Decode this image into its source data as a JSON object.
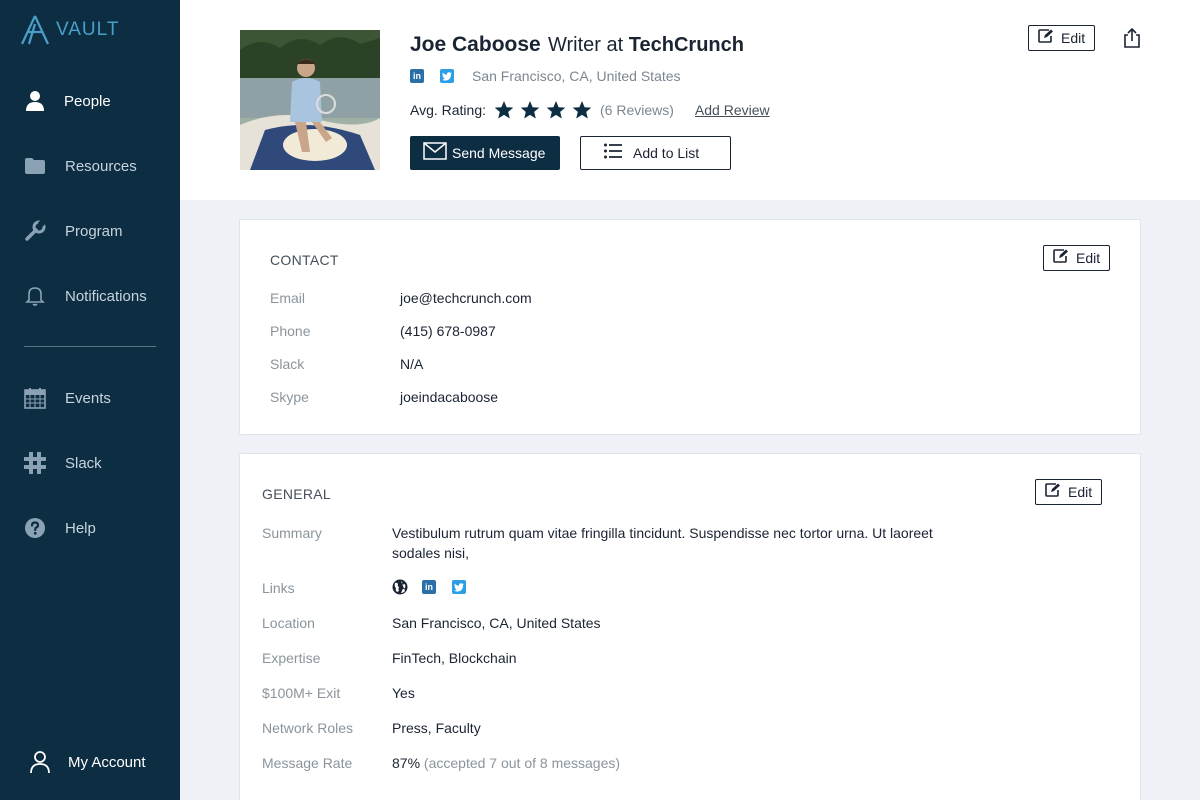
{
  "brand": {
    "name": "VAULT"
  },
  "sidebar": {
    "items": [
      {
        "label": "People",
        "icon": "person-icon"
      },
      {
        "label": "Resources",
        "icon": "folder-icon"
      },
      {
        "label": "Program",
        "icon": "wrench-icon"
      },
      {
        "label": "Notifications",
        "icon": "bell-icon"
      },
      {
        "label": "Events",
        "icon": "calendar-icon"
      },
      {
        "label": "Slack",
        "icon": "slack-icon"
      },
      {
        "label": "Help",
        "icon": "help-icon"
      }
    ],
    "account_label": "My Account"
  },
  "profile": {
    "name": "Joe Caboose",
    "role_prefix": "Writer at",
    "company": "TechCrunch",
    "location": "San Francisco, CA, United States",
    "rating_label": "Avg. Rating:",
    "rating": 4,
    "rating_max": 4,
    "reviews": "(6 Reviews)",
    "add_review": "Add Review",
    "send_message": "Send Message",
    "add_to_list": "Add to List",
    "edit": "Edit"
  },
  "contact": {
    "title": "CONTACT",
    "edit": "Edit",
    "rows": [
      {
        "label": "Email",
        "value": "joe@techcrunch.com"
      },
      {
        "label": "Phone",
        "value": "(415) 678-0987"
      },
      {
        "label": "Slack",
        "value": "N/A"
      },
      {
        "label": "Skype",
        "value": "joeindacaboose"
      }
    ]
  },
  "general": {
    "title": "GENERAL",
    "edit": "Edit",
    "summary_label": "Summary",
    "summary_line1": "Vestibulum rutrum quam vitae fringilla tincidunt. Suspendisse nec tortor urna. Ut laoreet",
    "summary_line2": "sodales nisi,",
    "links_label": "Links",
    "location_label": "Location",
    "location_value": "San Francisco, CA, United States",
    "expertise_label": "Expertise",
    "expertise_value": "FinTech, Blockchain",
    "exit_label": "$100M+ Exit",
    "exit_value": "Yes",
    "roles_label": "Network Roles",
    "roles_value": "Press, Faculty",
    "rate_label": "Message Rate",
    "rate_value": "87%",
    "rate_detail": "(accepted 7 out of 8 messages)"
  },
  "colors": {
    "sidebar": "#0d2d42",
    "accent": "#4a9fc9",
    "linkedin": "#2a6fa8",
    "twitter": "#2b9fe6"
  }
}
